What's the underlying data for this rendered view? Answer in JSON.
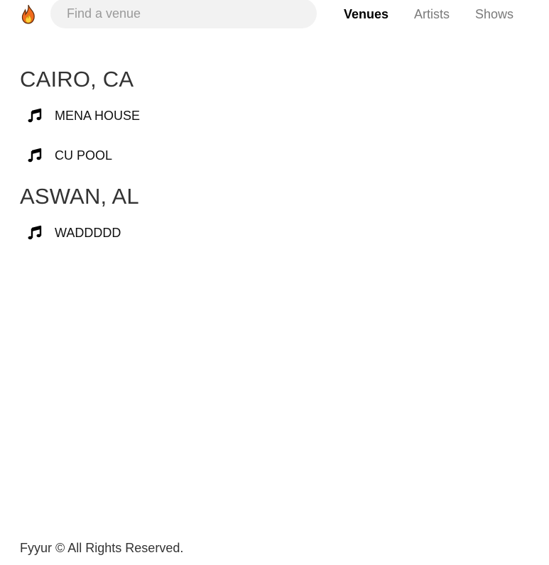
{
  "header": {
    "logo": "fire-icon",
    "search_placeholder": "Find a venue",
    "search_value": "",
    "nav": {
      "venues": "Venues",
      "artists": "Artists",
      "shows": "Shows",
      "active": "Venues"
    }
  },
  "groups": [
    {
      "city": "CAIRO, CA",
      "venues": [
        {
          "name": "MENA HOUSE",
          "icon": "music-note-icon"
        },
        {
          "name": "CU POOL",
          "icon": "music-note-icon"
        }
      ]
    },
    {
      "city": "ASWAN, AL",
      "venues": [
        {
          "name": "WADDDDD",
          "icon": "music-note-icon"
        }
      ]
    }
  ],
  "footer": {
    "text": "Fyyur © All Rights Reserved."
  }
}
